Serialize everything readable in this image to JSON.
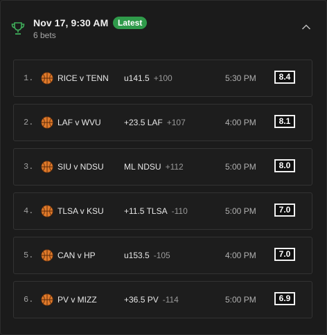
{
  "header": {
    "title": "Nov 17, 9:30 AM",
    "badge": "Latest",
    "subtitle": "6 bets",
    "icon": "trophy-icon",
    "collapse_icon": "chevron-up-icon"
  },
  "colors": {
    "accent_green": "#2f9a4a",
    "trophy_green": "#3fae5a",
    "ball_orange": "#e07a2a"
  },
  "bets": [
    {
      "rank": "1.",
      "matchup": "RICE v TENN",
      "line": "u141.5",
      "odds": "+100",
      "time": "5:30 PM",
      "score": "8.4"
    },
    {
      "rank": "2.",
      "matchup": "LAF v WVU",
      "line": "+23.5 LAF",
      "odds": "+107",
      "time": "4:00 PM",
      "score": "8.1"
    },
    {
      "rank": "3.",
      "matchup": "SIU v NDSU",
      "line": "ML NDSU",
      "odds": "+112",
      "time": "5:00 PM",
      "score": "8.0"
    },
    {
      "rank": "4.",
      "matchup": "TLSA v KSU",
      "line": "+11.5 TLSA",
      "odds": "-110",
      "time": "5:00 PM",
      "score": "7.0"
    },
    {
      "rank": "5.",
      "matchup": "CAN v HP",
      "line": "u153.5",
      "odds": "-105",
      "time": "4:00 PM",
      "score": "7.0"
    },
    {
      "rank": "6.",
      "matchup": "PV v MIZZ",
      "line": "+36.5 PV",
      "odds": "-114",
      "time": "5:00 PM",
      "score": "6.9"
    }
  ]
}
